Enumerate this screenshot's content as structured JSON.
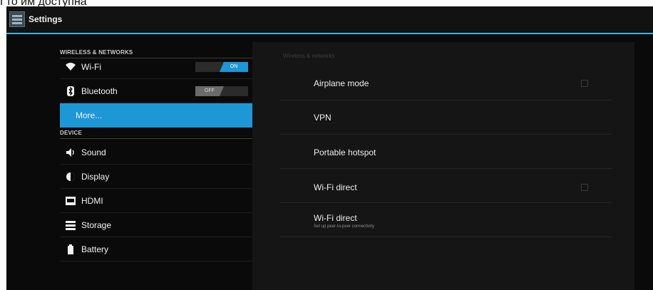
{
  "header_cutoff_text": "Гто им доступна",
  "app": {
    "title": "Settings",
    "icon": "settings-app-icon"
  },
  "sidebar": {
    "sections": [
      {
        "label": "WIRELESS & NETWORKS"
      },
      {
        "label": "DEVICE"
      }
    ],
    "items": [
      {
        "label": "Wi-Fi",
        "icon": "wifi-icon",
        "toggle": "ON"
      },
      {
        "label": "Bluetooth",
        "icon": "bluetooth-icon",
        "toggle": "OFF"
      },
      {
        "label": "More...",
        "selected": true
      },
      {
        "label": "Sound",
        "icon": "sound-icon"
      },
      {
        "label": "Display",
        "icon": "display-icon"
      },
      {
        "label": "HDMI",
        "icon": "hdmi-icon"
      },
      {
        "label": "Storage",
        "icon": "storage-icon"
      },
      {
        "label": "Battery",
        "icon": "battery-icon"
      }
    ]
  },
  "main": {
    "header": "Wireless & networks",
    "settings": [
      {
        "title": "Airplane mode",
        "checkbox": true,
        "checked": false
      },
      {
        "title": "VPN"
      },
      {
        "title": "Portable hotspot"
      },
      {
        "title": "Wi-Fi direct",
        "checkbox": true,
        "checked": false
      },
      {
        "title": "Wi-Fi direct",
        "summary": "Set up peer-to-peer connectivity"
      }
    ]
  },
  "colors": {
    "accent": "#33b5e5",
    "selected": "#1e97d6",
    "background": "#0a0a0a"
  }
}
